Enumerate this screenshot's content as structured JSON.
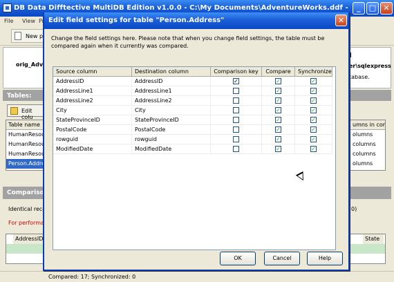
{
  "main": {
    "title": "DB Data Difftective MultiDB Edition v1.0.0 - C:\\My Documents\\AdventureWorks.ddf -",
    "menu": [
      "File",
      "View",
      "Pr"
    ],
    "toolbar_new": "New pr",
    "left_db": "orig_Adve",
    "right_db_line1": "]",
    "right_db_line2": "er\\sqlexpress",
    "right_db_line3": "tabase.",
    "tables_header": "Tables:",
    "edit_button": "Edit colu",
    "table_col_header": "Table name",
    "table_rows": [
      "HumanResou",
      "HumanResou",
      "HumanResou",
      "Person.Addre"
    ],
    "right_col_header": "umns in compari",
    "right_col_rows": [
      "olumns",
      "columns",
      "columns",
      "olumns"
    ],
    "comparison_header": "Comparison",
    "identical_label": "Identical recor",
    "perf_label": "For performan",
    "count_label": "0)",
    "bottom_col1": "AddressID",
    "bottom_col2": "State",
    "status": "Compared: 17; Synchronized: 0"
  },
  "dialog": {
    "title": "Edit field settings for table \"Person.Address\"",
    "note": "Change the field settings here. Please note that when you change field settings, the table must be compared again when it currently was compared.",
    "headers": [
      "Source column",
      "Destination column",
      "Comparison key",
      "Compare",
      "Synchronize"
    ],
    "rows": [
      {
        "src": "AddressID",
        "dst": "AddressID",
        "key": true,
        "cmp": true,
        "sync": true
      },
      {
        "src": "AddressLine1",
        "dst": "AddressLine1",
        "key": false,
        "cmp": true,
        "sync": true
      },
      {
        "src": "AddressLine2",
        "dst": "AddressLine2",
        "key": false,
        "cmp": true,
        "sync": true
      },
      {
        "src": "City",
        "dst": "City",
        "key": false,
        "cmp": true,
        "sync": true
      },
      {
        "src": "StateProvinceID",
        "dst": "StateProvinceID",
        "key": false,
        "cmp": true,
        "sync": true
      },
      {
        "src": "PostalCode",
        "dst": "PostalCode",
        "key": false,
        "cmp": true,
        "sync": true
      },
      {
        "src": "rowguid",
        "dst": "rowguid",
        "key": false,
        "cmp": true,
        "sync": true
      },
      {
        "src": "ModifiedDate",
        "dst": "ModifiedDate",
        "key": false,
        "cmp": true,
        "sync": true
      }
    ],
    "ok": "OK",
    "cancel": "Cancel",
    "help": "Help"
  }
}
